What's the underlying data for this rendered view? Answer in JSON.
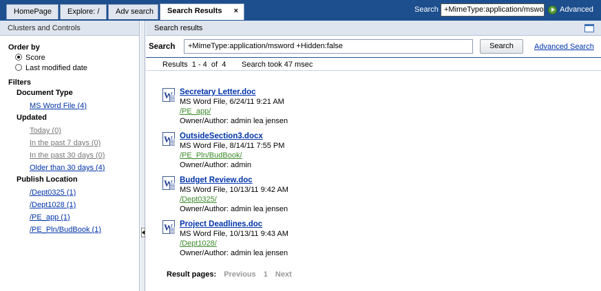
{
  "tabs": [
    {
      "label": "HomePage"
    },
    {
      "label": "Explore: /"
    },
    {
      "label": "Adv search"
    },
    {
      "label": "Search Results",
      "close": "×"
    }
  ],
  "top_search": {
    "label": "Search",
    "value": "+MimeType:application/msword",
    "advanced": "Advanced"
  },
  "left": {
    "header": "Clusters and Controls",
    "order_by": "Order by",
    "order_options": [
      {
        "label": "Score",
        "selected": true
      },
      {
        "label": "Last modified date",
        "selected": false
      }
    ],
    "filters": "Filters",
    "document_type": "Document Type",
    "doc_type_items": [
      "MS Word File (4)"
    ],
    "updated": "Updated",
    "updated_items": [
      "Today (0)",
      "In the past 7 days (0)",
      "In the past 30 days (0)",
      "Older than 30 days (4)"
    ],
    "publish_location": "Publish Location",
    "location_items": [
      "/Dept0325 (1)",
      "/Dept1028 (1)",
      "/PE_app (1)",
      "/PE_Pln/BudBook (1)"
    ]
  },
  "right": {
    "header": "Search results",
    "search_label": "Search",
    "search_value": "+MimeType:application/msword +Hidden:false",
    "search_button": "Search",
    "advanced_link": "Advanced Search",
    "results_count": "Results  1 - 4  of  4",
    "results_time": "Search took 47 msec",
    "results": [
      {
        "title": "Secretary Letter.doc",
        "meta": "MS Word File, 6/24/11 9:21 AM",
        "path": "/PE_app/",
        "owner": "Owner/Author: admin lea jensen"
      },
      {
        "title": "OutsideSection3.docx",
        "meta": "MS Word File, 8/14/11 7:55 PM",
        "path": "/PE_Pln/BudBook/",
        "owner": "Owner/Author: admin"
      },
      {
        "title": "Budget Review.doc",
        "meta": "MS Word File, 10/13/11 9:42 AM",
        "path": "/Dept0325/",
        "owner": "Owner/Author: admin lea jensen"
      },
      {
        "title": "Project Deadlines.doc",
        "meta": "MS Word File, 10/13/11 9:43 AM",
        "path": "/Dept1028/",
        "owner": "Owner/Author: admin lea jensen"
      }
    ],
    "pager": {
      "label": "Result pages:",
      "previous": "Previous",
      "page": "1",
      "next": "Next"
    }
  },
  "colors": {
    "topbar": "#1d4f8f",
    "link": "#0033aa",
    "path": "#3b8a2a"
  }
}
